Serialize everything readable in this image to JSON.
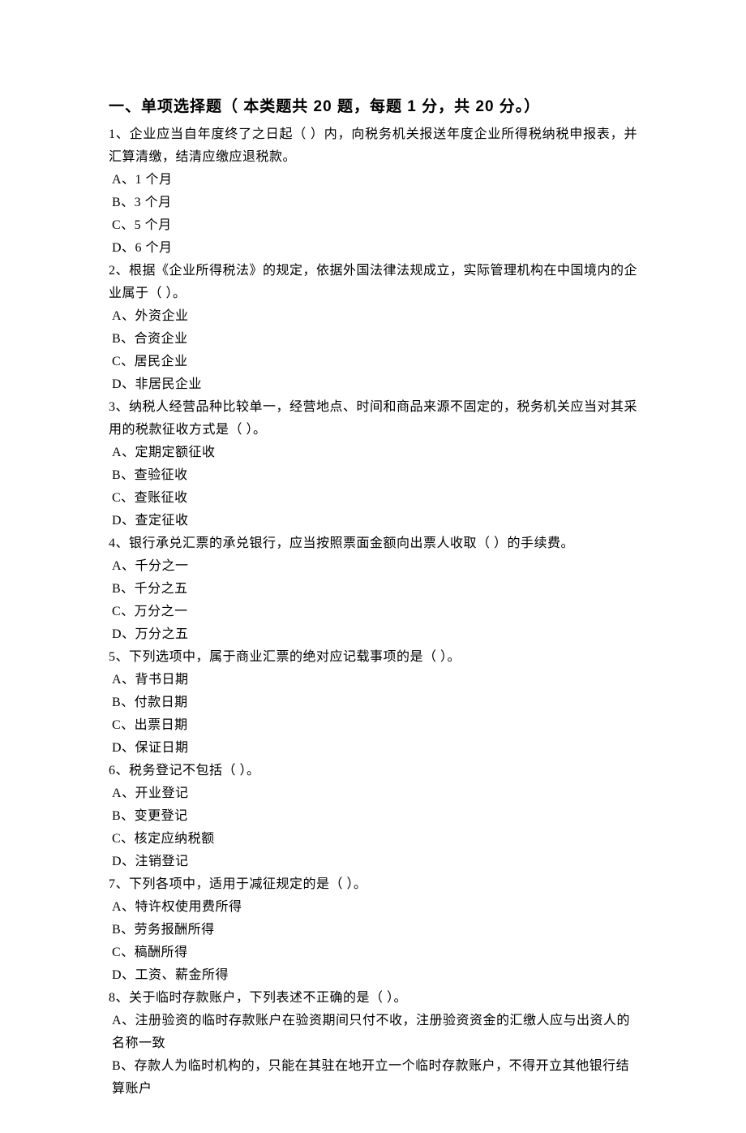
{
  "section_title": "一、单项选择题（ 本类题共 20 题，每题 1 分，共 20 分。）",
  "questions": [
    {
      "stem": "1、企业应当自年度终了之日起（  ）内，向税务机关报送年度企业所得税纳税申报表，并汇算清缴，结清应缴应退税款。",
      "opts": [
        "A、1 个月",
        "B、3 个月",
        "C、5 个月",
        "D、6 个月"
      ]
    },
    {
      "stem": "2、根据《企业所得税法》的规定，依据外国法律法规成立，实际管理机构在中国境内的企业属于（  ）。",
      "opts": [
        "A、外资企业",
        "B、合资企业",
        "C、居民企业",
        "D、非居民企业"
      ]
    },
    {
      "stem": "3、纳税人经营品种比较单一，经营地点、时间和商品来源不固定的，税务机关应当对其采用的税款征收方式是（  ）。",
      "opts": [
        "A、定期定额征收",
        "B、查验征收",
        "C、查账征收",
        "D、查定征收"
      ]
    },
    {
      "stem": "4、银行承兑汇票的承兑银行，应当按照票面金额向出票人收取（  ）的手续费。",
      "opts": [
        "A、千分之一",
        "B、千分之五",
        "C、万分之一",
        "D、万分之五"
      ]
    },
    {
      "stem": "5、下列选项中，属于商业汇票的绝对应记载事项的是（  ）。",
      "opts": [
        "A、背书日期",
        "B、付款日期",
        "C、出票日期",
        "D、保证日期"
      ]
    },
    {
      "stem": "6、税务登记不包括（  ）。",
      "opts": [
        "A、开业登记",
        "B、变更登记",
        "C、核定应纳税额",
        "D、注销登记"
      ]
    },
    {
      "stem": "7、下列各项中，适用于减征规定的是（  ）。",
      "opts": [
        "A、特许权使用费所得",
        "B、劳务报酬所得",
        "C、稿酬所得",
        "D、工资、薪金所得"
      ]
    },
    {
      "stem": "8、关于临时存款账户，下列表述不正确的是（  ）。",
      "opts": [
        "A、注册验资的临时存款账户在验资期间只付不收，注册验资资金的汇缴人应与出资人的名称一致",
        "B、存款人为临时机构的，只能在其驻在地开立一个临时存款账户，不得开立其他银行结算账户"
      ]
    }
  ]
}
